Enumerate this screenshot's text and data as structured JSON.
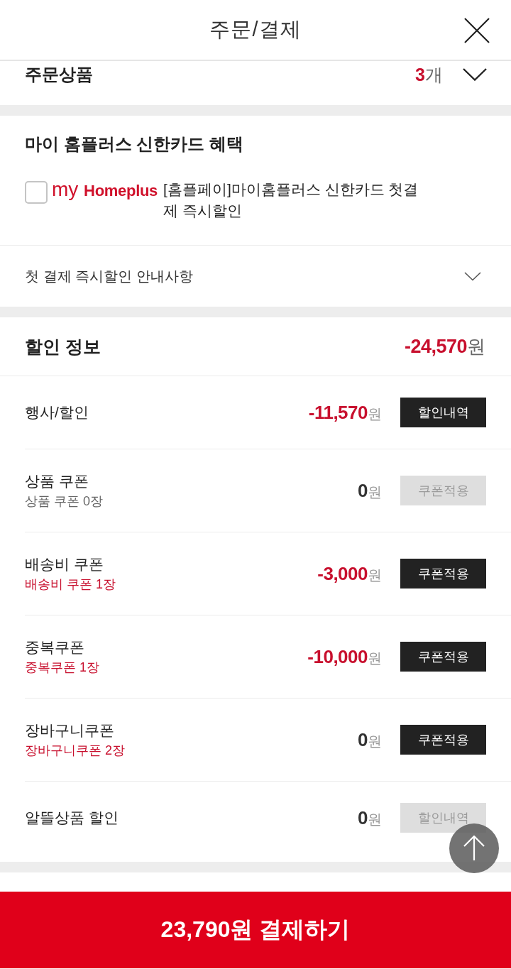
{
  "header": {
    "title": "주문/결제"
  },
  "order_products": {
    "label": "주문상품",
    "count": "3",
    "unit": "개",
    "expanded": false
  },
  "card_benefit": {
    "title": "마이 홈플러스 신한카드 혜택",
    "option": {
      "checked": false,
      "logo": "my **Homeplus**",
      "text": "[홈플페이]마이홈플러스 신한카드 첫결제 즉시할인"
    },
    "notice": {
      "label": "첫 결제 즉시할인 안내사항",
      "expanded": false
    }
  },
  "discount": {
    "title": "할인 정보",
    "total": "-24,570",
    "total_unit": "원",
    "rows": [
      {
        "label": "행사/할인",
        "amount": "-11,570",
        "unit": "원",
        "highlighted": true,
        "button": {
          "label": "할인내역",
          "disabled": false
        }
      },
      {
        "label": "상품 쿠폰",
        "sub": "상품 쿠폰 0장",
        "sub_highlighted": false,
        "amount": "0",
        "unit": "원",
        "highlighted": false,
        "button": {
          "label": "쿠폰적용",
          "disabled": true
        }
      },
      {
        "label": "배송비 쿠폰",
        "sub": "배송비 쿠폰 1장",
        "sub_highlighted": true,
        "amount": "-3,000",
        "unit": "원",
        "highlighted": true,
        "button": {
          "label": "쿠폰적용",
          "disabled": false
        }
      },
      {
        "label": "중복쿠폰",
        "sub": "중복쿠폰 1장",
        "sub_highlighted": true,
        "amount": "-10,000",
        "unit": "원",
        "highlighted": true,
        "button": {
          "label": "쿠폰적용",
          "disabled": false
        }
      },
      {
        "label": "장바구니쿠폰",
        "sub": "장바구니쿠폰 2장",
        "sub_highlighted": true,
        "amount": "0",
        "unit": "원",
        "highlighted": false,
        "button": {
          "label": "쿠폰적용",
          "disabled": false
        }
      },
      {
        "label": "알뜰상품 할인",
        "amount": "0",
        "unit": "원",
        "highlighted": false,
        "button": {
          "label": "할인내역",
          "disabled": true
        }
      }
    ]
  },
  "pay_button": {
    "label": "23,790원 결제하기"
  }
}
